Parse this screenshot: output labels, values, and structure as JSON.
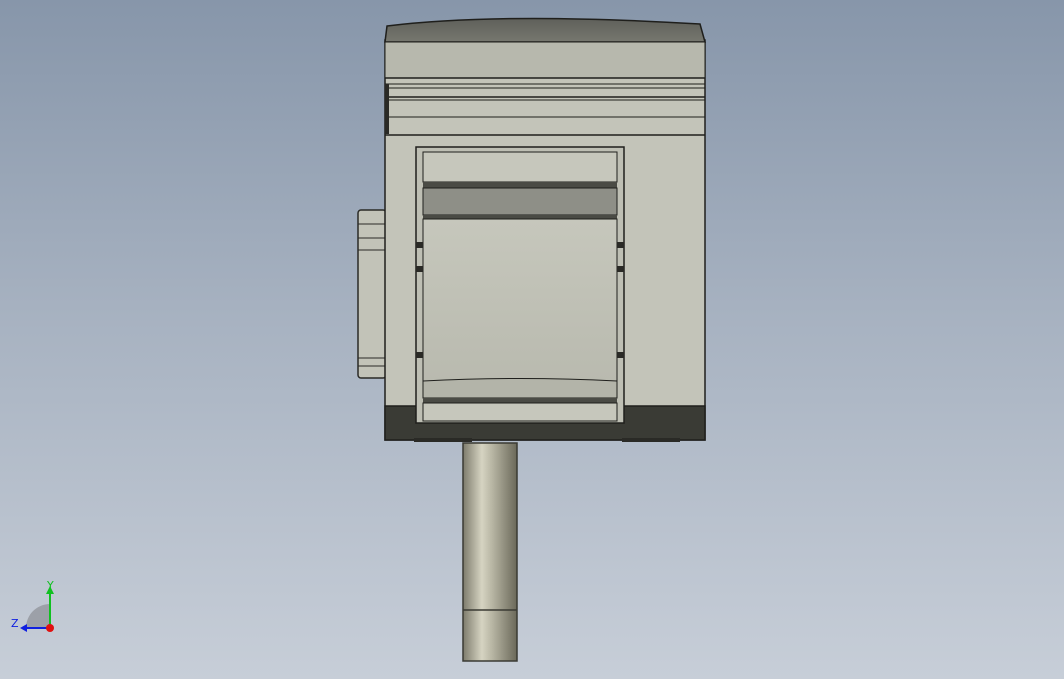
{
  "viewport": {
    "name": "3D model view",
    "background_top": "#8796aa",
    "background_bottom": "#c7ced8"
  },
  "model": {
    "body_color": "#c3c4b9",
    "top_cap_color": "#6e6f69",
    "base_color": "#3a3b35",
    "shaft_color": "#b9b7a4"
  },
  "triad": {
    "x_label": "",
    "y_label": "Y",
    "z_label": "Z",
    "x_color": "#e01010",
    "y_color": "#10c020",
    "z_color": "#1020e0"
  }
}
